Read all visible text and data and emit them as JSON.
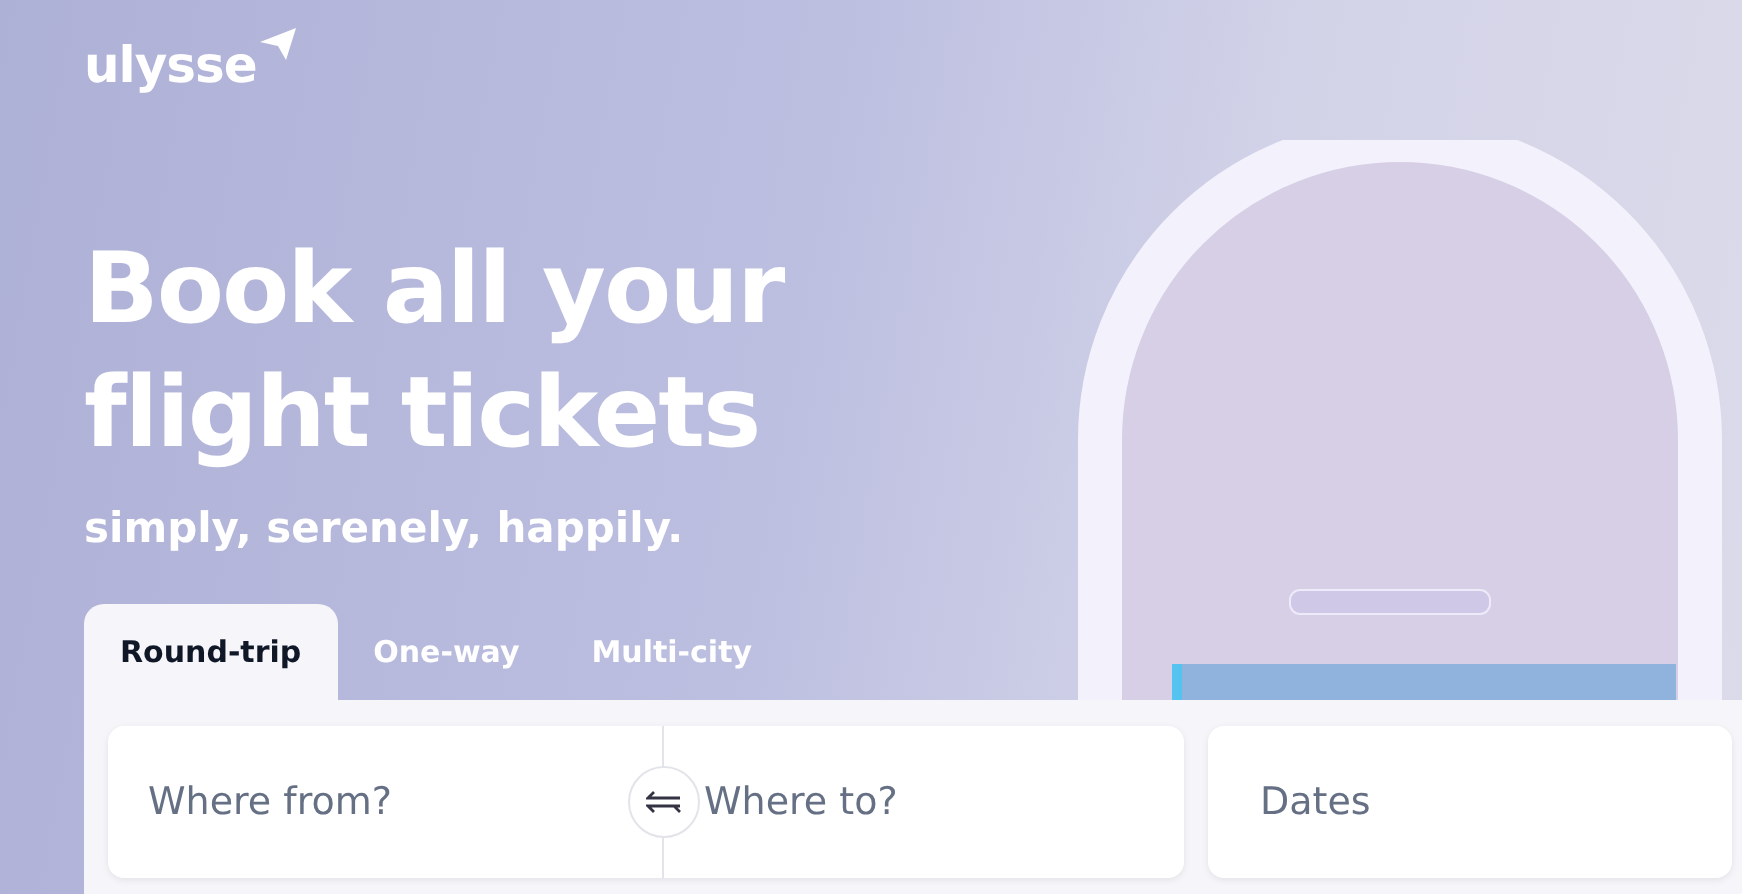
{
  "logo": {
    "text": "ulysse"
  },
  "hero": {
    "title": "Book all your flight tickets",
    "subtitle": "simply, serenely, happily."
  },
  "tabs": [
    {
      "label": "Round-trip",
      "selected": true
    },
    {
      "label": "One-way",
      "selected": false
    },
    {
      "label": "Multi-city",
      "selected": false
    }
  ],
  "search": {
    "from": {
      "placeholder": "Where from?"
    },
    "to": {
      "placeholder": "Where to?"
    },
    "dates": {
      "placeholder": "Dates"
    }
  }
}
